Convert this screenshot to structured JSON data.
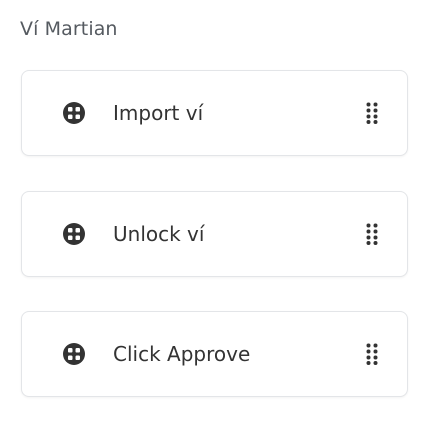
{
  "section": {
    "title": "Ví Martian"
  },
  "steps": [
    {
      "label": "Import ví",
      "icon": "globe-grid-icon"
    },
    {
      "label": "Unlock ví",
      "icon": "globe-grid-icon"
    },
    {
      "label": "Click Approve",
      "icon": "globe-grid-icon"
    }
  ],
  "colors": {
    "title": "#555a60",
    "text": "#333333",
    "icon": "#333333",
    "border": "#e3e5e8",
    "handle": "#333333"
  }
}
